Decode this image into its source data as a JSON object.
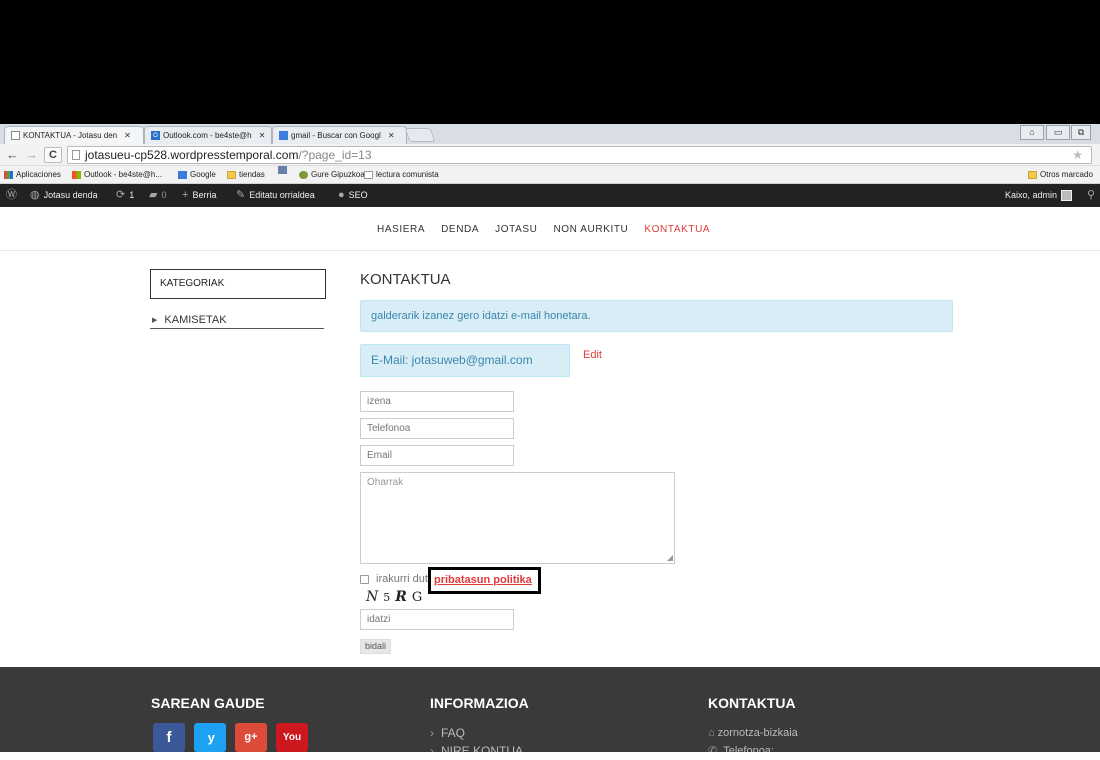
{
  "browser": {
    "tabs": [
      {
        "label": "KONTAKTUA - Jotasu den",
        "active": true
      },
      {
        "label": "Outlook.com - be4ste@h",
        "active": false
      },
      {
        "label": "gmail - Buscar con Googl",
        "active": false
      }
    ],
    "url_host": "jotasueu-cp528.wordpresstemporal.com",
    "url_query": "/?page_id=13",
    "bookmarks": [
      {
        "label": "Aplicaciones"
      },
      {
        "label": "Outlook - be4ste@h..."
      },
      {
        "label": "Google"
      },
      {
        "label": "tiendas"
      },
      {
        "label": "Gure Gipuzkoa"
      },
      {
        "label": "lectura comunista"
      }
    ],
    "other_bookmarks": "Otros marcado"
  },
  "adminbar": {
    "site_name": "Jotasu denda",
    "updates_count": "1",
    "comments_count": "0",
    "new_label": "Berria",
    "edit_page_label": "Editatu orrialdea",
    "seo_label": "SEO",
    "greeting": "Kaixo, admin"
  },
  "nav": {
    "items": [
      "HASIERA",
      "DENDA",
      "JOTASU",
      "NON AURKITU",
      "KONTAKTUA"
    ],
    "active_index": 4
  },
  "sidebar": {
    "heading": "KATEGORIAK",
    "items": [
      {
        "label": "KAMISETAK"
      }
    ]
  },
  "content": {
    "title": "KONTAKTUA",
    "info_text": "galderarik izanez gero idatzi e-mail honetara.",
    "email_text": "E-Mail: jotasuweb@gmail.com",
    "edit_label": "Edit"
  },
  "form": {
    "name_placeholder": "izena",
    "phone_placeholder": "Telefonoa",
    "email_placeholder": "Email",
    "notes_placeholder": "Oharrak",
    "consent_label": "irakurri dut",
    "privacy_link": "pribatasun politika",
    "captcha": {
      "c1": "N",
      "c2": "5",
      "c3": "R",
      "c4": "G"
    },
    "captcha_input_placeholder": "idatzi",
    "submit_label": "bidali"
  },
  "footer": {
    "col1_title": "SAREAN GAUDE",
    "social": [
      {
        "glyph": "f"
      },
      {
        "glyph": " y"
      },
      {
        "glyph": "g+"
      },
      {
        "glyph": "You"
      }
    ],
    "col2_title": "INFORMAZIOA",
    "col2_links": [
      "FAQ",
      "NIRE KONTUA"
    ],
    "col3_title": "KONTAKTUA",
    "col3_items": [
      "zornotza-bizkaia",
      "Telefonoa:"
    ]
  },
  "colors": {
    "accent_red": "#e03a3a",
    "info_bg": "#d9edf7",
    "info_text": "#3a87ad",
    "footer_bg": "#3a3a3a",
    "adminbar_bg": "#222222"
  }
}
